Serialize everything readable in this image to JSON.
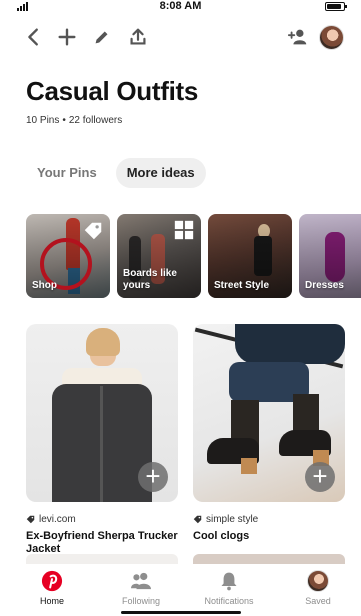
{
  "status_bar": {
    "time": "8:08 AM"
  },
  "toolbar": {
    "back_icon": "chevron-left-icon",
    "add_icon": "plus-icon",
    "edit_icon": "pencil-icon",
    "share_icon": "share-icon",
    "add_collaborator_icon": "add-person-icon"
  },
  "board": {
    "title": "Casual Outfits",
    "pins_count": "10 Pins",
    "separator": "•",
    "followers": "22 followers"
  },
  "tabs": [
    {
      "label": "Your Pins",
      "active": false
    },
    {
      "label": "More ideas",
      "active": true
    }
  ],
  "ideas": [
    {
      "label": "Shop",
      "icon": "tag-icon"
    },
    {
      "label": "Boards like yours",
      "icon": "grid-icon"
    },
    {
      "label": "Street Style",
      "icon": ""
    },
    {
      "label": "Dresses",
      "icon": ""
    }
  ],
  "pins": [
    {
      "source": "levi.com",
      "title": "Ex-Boyfriend Sherpa Trucker Jacket",
      "save_label": "+"
    },
    {
      "source": "simple style",
      "title": "Cool clogs",
      "save_label": "+"
    }
  ],
  "nav": [
    {
      "label": "Home",
      "icon": "pinterest-logo-icon",
      "active": true
    },
    {
      "label": "Following",
      "icon": "people-icon",
      "active": false
    },
    {
      "label": "Notifications",
      "icon": "bell-icon",
      "active": false
    },
    {
      "label": "Saved",
      "icon": "avatar",
      "active": false
    }
  ],
  "colors": {
    "brand": "#e60023",
    "tab_active_bg": "#efefef",
    "muted": "#8e8e8e"
  }
}
